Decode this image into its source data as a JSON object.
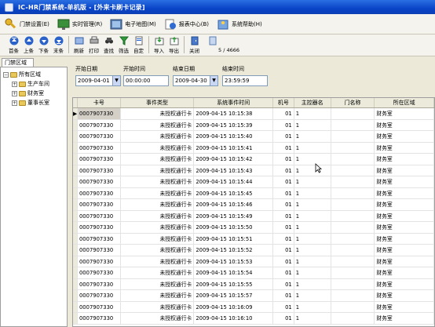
{
  "window": {
    "title": "IC-HR门禁系统-单机版 - [外来卡刷卡记录]"
  },
  "menu": [
    {
      "label": "门禁设置(E)",
      "icon": "key-icon"
    },
    {
      "label": "实时管理(R)",
      "icon": "monitor-icon"
    },
    {
      "label": "电子地图(M)",
      "icon": "map-icon"
    },
    {
      "label": "报表中心(B)",
      "icon": "report-icon"
    },
    {
      "label": "系统帮助(H)",
      "icon": "help-icon"
    }
  ],
  "toolbar": {
    "buttons": [
      "首条",
      "上条",
      "下条",
      "末条",
      "刷新",
      "打印",
      "查找",
      "筛选",
      "自定",
      "导入",
      "导出",
      "关闭"
    ],
    "page": "5 / 4666"
  },
  "left_tab": "门禁区域",
  "tree": {
    "root": "所有区域",
    "children": [
      "生产车间",
      "财务室",
      "董事长室"
    ]
  },
  "filter": {
    "start_date_label": "开始日期",
    "start_time_label": "开始时间",
    "end_date_label": "结束日期",
    "end_time_label": "结束时间",
    "start_date": "2009-04-01",
    "start_time": "00:00:00",
    "end_date": "2009-04-30",
    "end_time": "23:59:59"
  },
  "grid": {
    "columns": [
      "卡号",
      "事件类型",
      "系统事件时间",
      "机号",
      "主控器名",
      "门名称",
      "所在区域"
    ],
    "rows": [
      [
        "0007907330",
        "未授权通行卡",
        "2009-04-15 10:15:38",
        "01",
        "1",
        "",
        "财务室"
      ],
      [
        "0007907330",
        "未授权通行卡",
        "2009-04-15 10:15:39",
        "01",
        "1",
        "",
        "财务室"
      ],
      [
        "0007907330",
        "未授权通行卡",
        "2009-04-15 10:15:40",
        "01",
        "1",
        "",
        "财务室"
      ],
      [
        "0007907330",
        "未授权通行卡",
        "2009-04-15 10:15:41",
        "01",
        "1",
        "",
        "财务室"
      ],
      [
        "0007907330",
        "未授权通行卡",
        "2009-04-15 10:15:42",
        "01",
        "1",
        "",
        "财务室"
      ],
      [
        "0007907330",
        "未授权通行卡",
        "2009-04-15 10:15:43",
        "01",
        "1",
        "",
        "财务室"
      ],
      [
        "0007907330",
        "未授权通行卡",
        "2009-04-15 10:15:44",
        "01",
        "1",
        "",
        "财务室"
      ],
      [
        "0007907330",
        "未授权通行卡",
        "2009-04-15 10:15:45",
        "01",
        "1",
        "",
        "财务室"
      ],
      [
        "0007907330",
        "未授权通行卡",
        "2009-04-15 10:15:46",
        "01",
        "1",
        "",
        "财务室"
      ],
      [
        "0007907330",
        "未授权通行卡",
        "2009-04-15 10:15:49",
        "01",
        "1",
        "",
        "财务室"
      ],
      [
        "0007907330",
        "未授权通行卡",
        "2009-04-15 10:15:50",
        "01",
        "1",
        "",
        "财务室"
      ],
      [
        "0007907330",
        "未授权通行卡",
        "2009-04-15 10:15:51",
        "01",
        "1",
        "",
        "财务室"
      ],
      [
        "0007907330",
        "未授权通行卡",
        "2009-04-15 10:15:52",
        "01",
        "1",
        "",
        "财务室"
      ],
      [
        "0007907330",
        "未授权通行卡",
        "2009-04-15 10:15:53",
        "01",
        "1",
        "",
        "财务室"
      ],
      [
        "0007907330",
        "未授权通行卡",
        "2009-04-15 10:15:54",
        "01",
        "1",
        "",
        "财务室"
      ],
      [
        "0007907330",
        "未授权通行卡",
        "2009-04-15 10:15:55",
        "01",
        "1",
        "",
        "财务室"
      ],
      [
        "0007907330",
        "未授权通行卡",
        "2009-04-15 10:15:57",
        "01",
        "1",
        "",
        "财务室"
      ],
      [
        "0007907330",
        "未授权通行卡",
        "2009-04-15 10:16:09",
        "01",
        "1",
        "",
        "财务室"
      ],
      [
        "0007907330",
        "未授权通行卡",
        "2009-04-15 10:16:10",
        "01",
        "1",
        "",
        "财务室"
      ]
    ]
  }
}
